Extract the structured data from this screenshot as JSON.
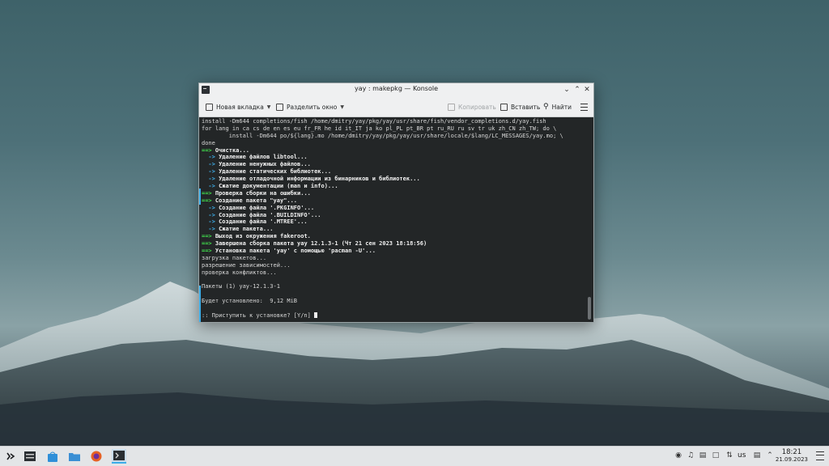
{
  "window": {
    "title": "yay : makepkg — Konsole"
  },
  "toolbar": {
    "new_tab": "Новая вкладка",
    "split_view": "Разделить окно",
    "copy": "Копировать",
    "paste": "Вставить",
    "find": "Найти"
  },
  "terminal": {
    "lines": [
      "install -Dm644 completions/fish /home/dmitry/yay/pkg/yay/usr/share/fish/vendor_completions.d/yay.fish",
      "for lang in ca cs de en es eu fr_FR he id it_IT ja ko pl_PL pt_BR pt ru_RU ru sv tr uk zh_CN zh_TW; do \\",
      "        install -Dm644 po/${lang}.mo /home/dmitry/yay/pkg/yay/usr/share/locale/$lang/LC_MESSAGES/yay.mo; \\",
      "done"
    ],
    "steps": [
      {
        "arrow": "==>",
        "text": "Очистка...",
        "kind": "main"
      },
      {
        "arrow": "  ->",
        "text": "Удаление файлов libtool...",
        "kind": "sub"
      },
      {
        "arrow": "  ->",
        "text": "Удаление ненужных файлов...",
        "kind": "sub"
      },
      {
        "arrow": "  ->",
        "text": "Удаление статических библиотек...",
        "kind": "sub"
      },
      {
        "arrow": "  ->",
        "text": "Удаление отладочной информации из бинарников и библиотек...",
        "kind": "sub"
      },
      {
        "arrow": "  ->",
        "text": "Сжатие документации (man и info)...",
        "kind": "sub"
      },
      {
        "arrow": "==>",
        "text": "Проверка сборки на ошибки...",
        "kind": "main"
      },
      {
        "arrow": "==>",
        "text": "Создание пакета \"yay\"...",
        "kind": "main"
      },
      {
        "arrow": "  ->",
        "text": "Создание файла '.PKGINFO'...",
        "kind": "sub"
      },
      {
        "arrow": "  ->",
        "text": "Создание файла '.BUILDINFO'...",
        "kind": "sub"
      },
      {
        "arrow": "  ->",
        "text": "Создание файла '.MTREE'...",
        "kind": "sub"
      },
      {
        "arrow": "  ->",
        "text": "Сжатие пакета...",
        "kind": "sub"
      },
      {
        "arrow": "==>",
        "text": "Выход из окружения fakeroot.",
        "kind": "main"
      },
      {
        "arrow": "==>",
        "text": "Завершена сборка пакета yay 12.1.3-1 (Чт 21 сен 2023 18:18:56)",
        "kind": "main"
      },
      {
        "arrow": "==>",
        "text": "Установка пакета 'yay' с помощью 'pacman -U'...",
        "kind": "main"
      }
    ],
    "tail": [
      "загрузка пакетов...",
      "разрешение зависимостей...",
      "проверка конфликтов...",
      "",
      "Пакеты (1) yay-12.1.3-1",
      "",
      "Будет установлено:  9,12 MiB",
      ""
    ],
    "prompt": ":: Приступить к установке? [Y/n] "
  },
  "tray": {
    "keyboard_layout": "us",
    "time": "18:21",
    "date": "21.09.2023"
  },
  "colors": {
    "accent": "#3daee9",
    "arrow_main": "#3fd64b",
    "arrow_sub": "#3daee9",
    "terminal_bg": "#232627"
  }
}
